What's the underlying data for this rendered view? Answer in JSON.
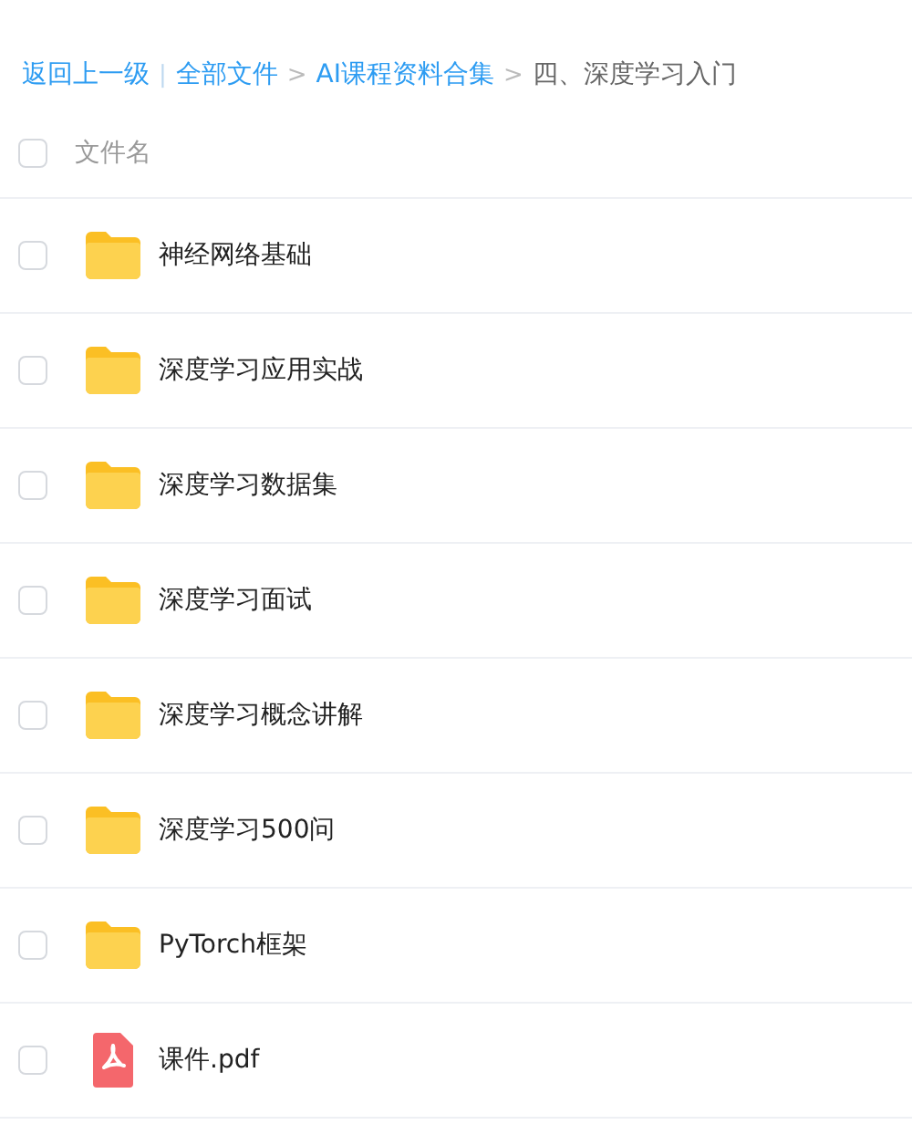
{
  "breadcrumb": {
    "back": "返回上一级",
    "divider": "|",
    "items": [
      {
        "label": "全部文件",
        "current": false
      },
      {
        "label": "AI课程资料合集",
        "current": false
      },
      {
        "label": "四、深度学习入门",
        "current": true
      }
    ],
    "separator": ">"
  },
  "header": {
    "label": "文件名",
    "checked": false
  },
  "files": [
    {
      "name": "神经网络基础",
      "kind": "folder",
      "checked": false
    },
    {
      "name": "深度学习应用实战",
      "kind": "folder",
      "checked": false
    },
    {
      "name": "深度学习数据集",
      "kind": "folder",
      "checked": false
    },
    {
      "name": "深度学习面试",
      "kind": "folder",
      "checked": false
    },
    {
      "name": "深度学习概念讲解",
      "kind": "folder",
      "checked": false
    },
    {
      "name": "深度学习500问",
      "kind": "folder",
      "checked": false
    },
    {
      "name": "PyTorch框架",
      "kind": "folder",
      "checked": false
    },
    {
      "name": "课件.pdf",
      "kind": "pdf",
      "checked": false
    }
  ]
}
